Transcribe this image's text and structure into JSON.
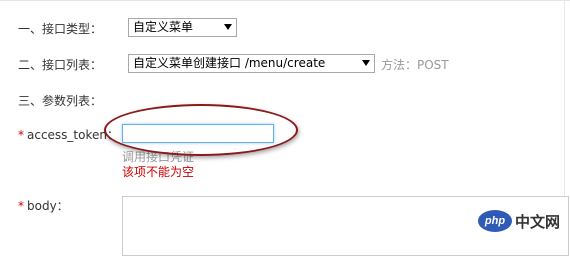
{
  "section1": {
    "label": "一、接口类型：",
    "select_value": "自定义菜单"
  },
  "section2": {
    "label": "二、接口列表：",
    "select_value": "自定义菜单创建接口 /menu/create",
    "method": "方法：POST"
  },
  "section3": {
    "label": "三、参数列表："
  },
  "access_token": {
    "required_mark": "*",
    "label": "access_token：",
    "value": "",
    "hint": "调用接口凭证",
    "error": "该项不能为空"
  },
  "body_field": {
    "required_mark": "*",
    "label": "body："
  },
  "watermark": {
    "badge": "php",
    "text": "中文网"
  }
}
